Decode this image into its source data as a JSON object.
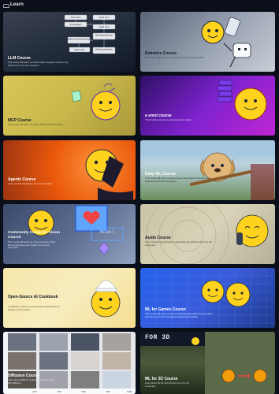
{
  "header": {
    "title": "Learn",
    "icon": "graduation-cap-icon"
  },
  "courses": [
    {
      "title": "LLM Course",
      "desc": "This course will teach you about large language models using libraries from the HF ecosystem",
      "nodes": [
        "Add & norm",
        "Add & norm",
        "Feed forward",
        "Add & norm",
        "Multi-head attention",
        "Masked multi-head attention",
        "Add & norm",
        "Multi-head attention"
      ]
    },
    {
      "title": "Robotics Course",
      "desc": "This course will learn you to build robots with using LeRobot"
    },
    {
      "title": "MCP Course",
      "desc": "This course will teach you about Model Context Protocol"
    },
    {
      "title": "a smol course",
      "desc": "This smollest course on post-training AI models"
    },
    {
      "title": "Agents Course",
      "desc": "Learn to build and deploy your own AI agents"
    },
    {
      "title": "Deep RL Course",
      "desc": "This course will teach you about deep reinforcement learning using libraries from the HF ecosystem"
    },
    {
      "title": "Community Computer Vision Course",
      "desc": "This course will teach you about computer vision ML using libraries and models from the HF ecosystem",
      "tag": "model"
    },
    {
      "title": "Audio Course",
      "desc": "Learn to apply transformers to audio data using libraries from the HF ecosystem"
    },
    {
      "title": "Open-Source AI Cookbook",
      "desc": "A collection of open-source powered notebooks by AI builders, for AI builders"
    },
    {
      "title": "ML for Games Course",
      "desc": "This course will teach you about integrating AI models into your game and using AI tools in your game development workflow"
    },
    {
      "title": "Diffusion Course",
      "desc": "Learn about diffusion models & how to use them with diffusers",
      "axis": [
        "200",
        "400",
        "600",
        "800",
        "1000"
      ]
    },
    {
      "title": "ML for 3D Course",
      "desc": "Learn about 3D ML with libraries from the HF ecosystem",
      "banner": "FOR 3D"
    }
  ],
  "colors": {
    "page_bg": "#0b0f19",
    "card_bg": "#111827",
    "hf_yellow": "#ffd21e",
    "hf_orange": "#ff9d00"
  }
}
